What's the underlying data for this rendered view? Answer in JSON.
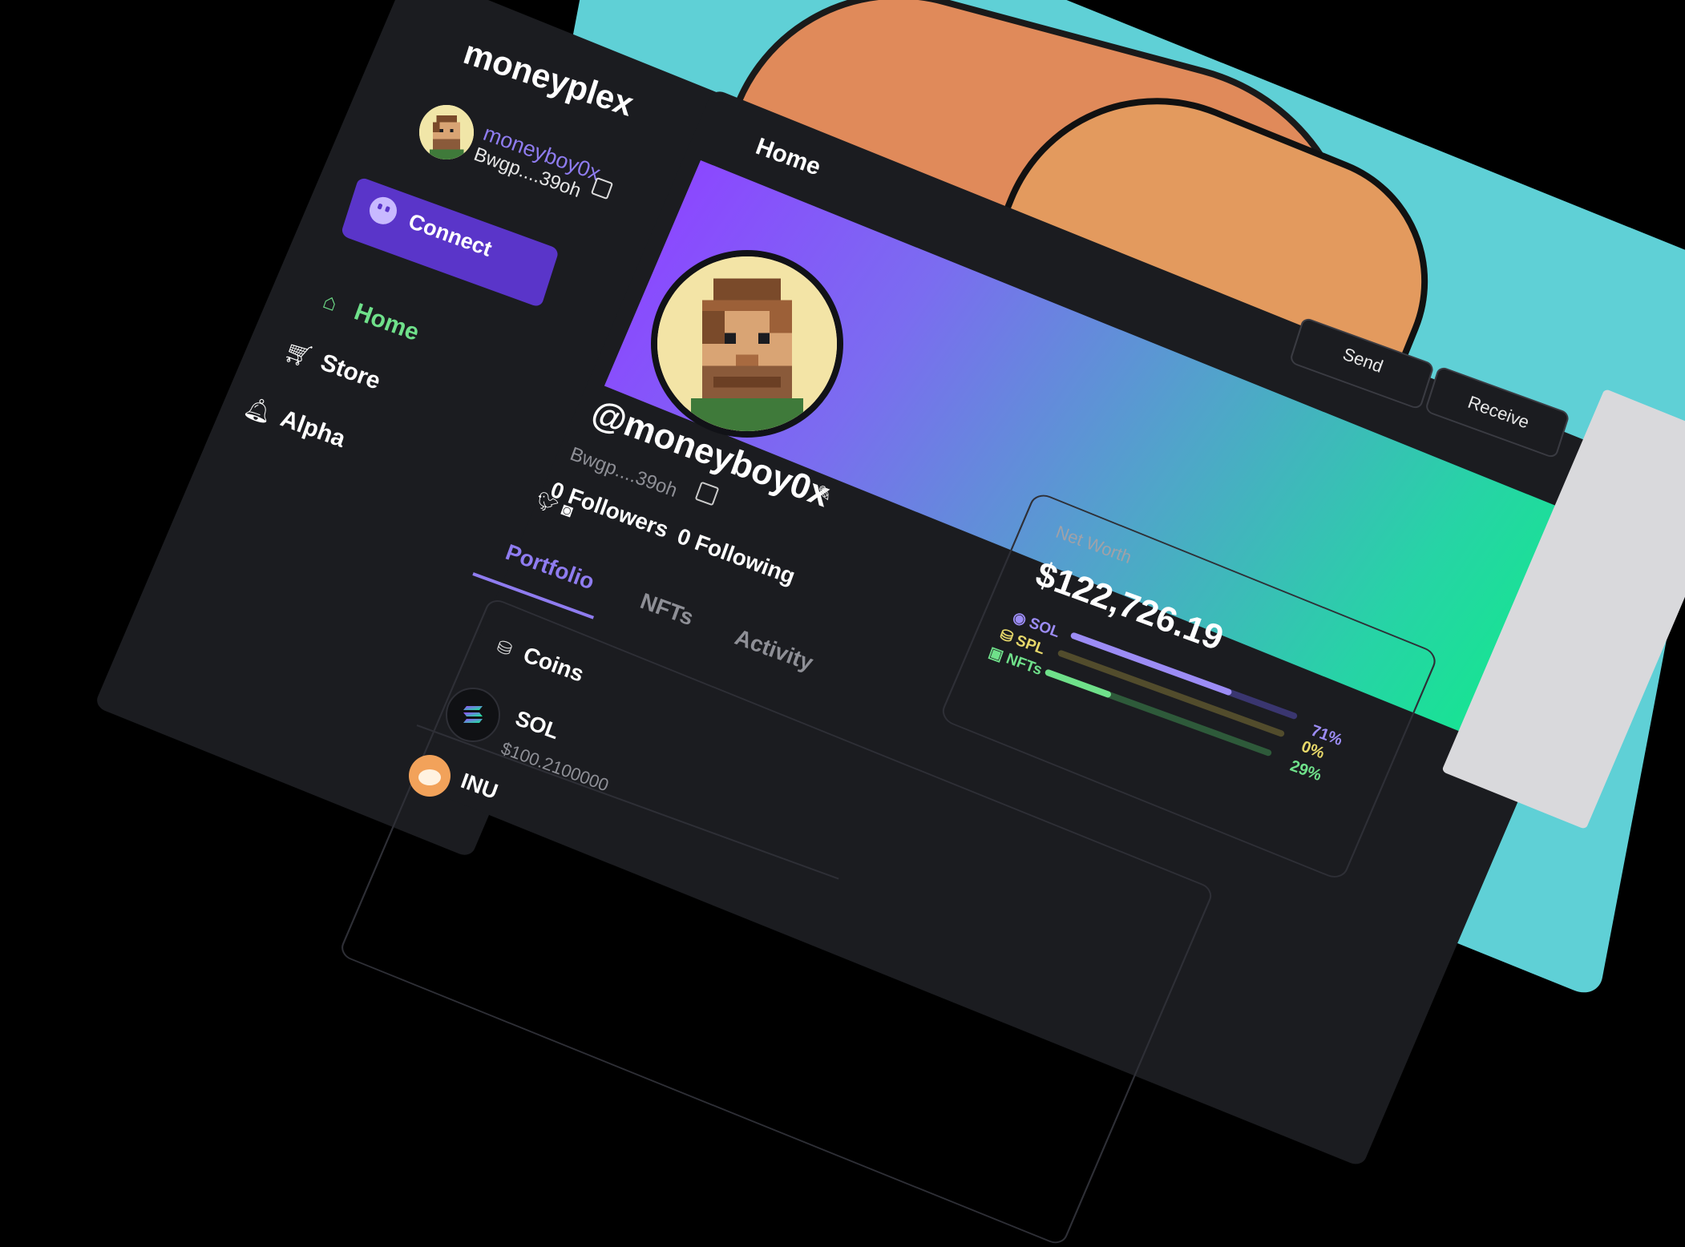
{
  "app": {
    "logo": "moneyplex"
  },
  "account": {
    "username": "moneyboy0x",
    "address": "Bwgp....39oh"
  },
  "sidebar": {
    "connect_label": "Connect",
    "items": [
      {
        "label": "Home",
        "icon": "home-icon",
        "active": true
      },
      {
        "label": "Store",
        "icon": "cart-icon",
        "active": false
      },
      {
        "label": "Alpha",
        "icon": "bell-icon",
        "active": false
      }
    ]
  },
  "header": {
    "title": "Home"
  },
  "profile": {
    "handle": "@moneyboy0x",
    "address": "Bwgp....39oh",
    "followers": "0 Followers",
    "following": "0 Following",
    "actions": {
      "send": "Send",
      "receive": "Receive"
    }
  },
  "tabs": [
    {
      "label": "Portfolio",
      "active": true
    },
    {
      "label": "NFTs",
      "active": false
    },
    {
      "label": "Activity",
      "active": false
    }
  ],
  "coins": {
    "title": "Coins",
    "items": [
      {
        "symbol": "SOL",
        "price": "$100.2100000"
      },
      {
        "symbol": "INU",
        "price": ""
      }
    ]
  },
  "net_worth": {
    "label": "Net Worth",
    "value": "$122,726.19",
    "allocation": [
      {
        "name": "SOL",
        "percent": "71%",
        "fraction": 0.71,
        "color": "#9c8cf5"
      },
      {
        "name": "SPL",
        "percent": "0%",
        "fraction": 0.0,
        "color": "#e7d86a"
      },
      {
        "name": "NFTs",
        "percent": "29%",
        "fraction": 0.29,
        "color": "#6fe08a"
      }
    ]
  },
  "colors": {
    "accent": "#8f7cf0",
    "connect_button": "#5a35c9",
    "active_nav": "#6fe08a",
    "panel": "#1b1c20"
  }
}
